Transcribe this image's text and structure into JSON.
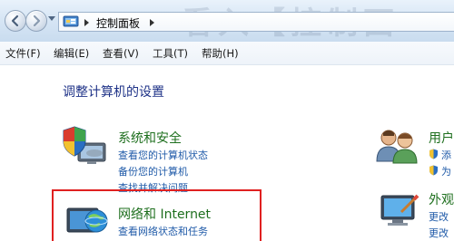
{
  "address_bar": {
    "breadcrumb": "控制面板",
    "watermark": "看入【控制面"
  },
  "menu": {
    "items": [
      "文件(F)",
      "编辑(E)",
      "查看(V)",
      "工具(T)",
      "帮助(H)"
    ]
  },
  "page": {
    "heading": "调整计算机的设置"
  },
  "categories": {
    "system": {
      "title": "系统和安全",
      "links": [
        "查看您的计算机状态",
        "备份您的计算机",
        "查找并解决问题"
      ]
    },
    "network": {
      "title": "网络和 Internet",
      "links": [
        "查看网络状态和任务"
      ]
    },
    "user": {
      "title": "用户",
      "links": [
        "添",
        "为"
      ]
    },
    "appearance": {
      "title": "外观",
      "links": [
        "更改",
        "更改"
      ]
    }
  },
  "colors": {
    "category_title": "#1e6f1e",
    "link": "#1f5aa8",
    "heading": "#1e3287",
    "highlight": "#e02020"
  },
  "icons": {
    "back": "back-arrow-icon",
    "forward": "forward-arrow-icon",
    "control_panel": "control-panel-icon",
    "system": "shield-computer-icon",
    "network": "network-globe-icon",
    "user": "user-accounts-icon",
    "appearance": "monitor-paint-icon"
  }
}
